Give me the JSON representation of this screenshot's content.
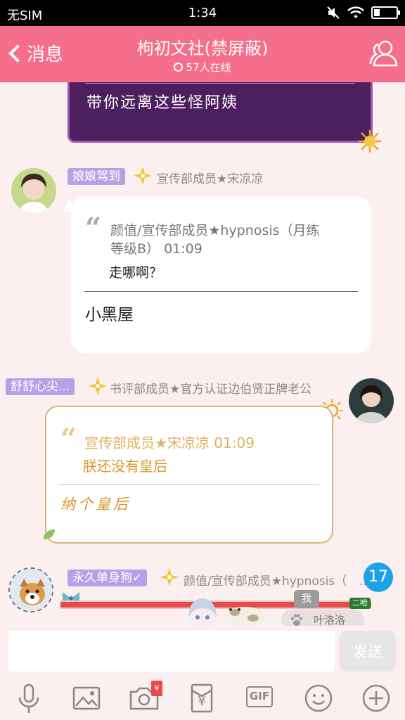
{
  "status": {
    "carrier": "无SIM",
    "time": "1:34"
  },
  "nav": {
    "back_label": "消息",
    "title": "枸初文社(禁屏蔽)",
    "online": "57人在线"
  },
  "messages": [
    {
      "text": "带你远离这些怪阿姨"
    },
    {
      "badge": "娘娘驾到",
      "meta": "宣传部成员★宋凉凉",
      "quote_head_1": "颜值/宣传部成员★hypnosis（月练",
      "quote_head_2": "等级B） 01:09",
      "quote_body": "走哪啊？",
      "reply": "小黑屋"
    },
    {
      "badge": "舒舒心尖...",
      "meta": "书评部成员★官方认证边伯贤正牌老公",
      "quote_head": "宣传部成员★宋凉凉 01:09",
      "quote_body": "朕还没有皇后",
      "reply": "纳个皇后"
    },
    {
      "badge": "永久单身狗✓",
      "meta": "颜值/宣传部成员★hypnosis（",
      "meta_trail": "..."
    }
  ],
  "unread_count": "17",
  "banner": {
    "tag": "二哈",
    "me": "我",
    "user": "叶洛洛"
  },
  "composer": {
    "placeholder": "",
    "send_label": "发送"
  },
  "toolbar": {
    "gif_label": "GIF",
    "red_packet_symbol": "¥"
  },
  "colors": {
    "nav_bg": "#f56f8c",
    "badge_bg": "#b8a0e8",
    "unread_bg": "#1ea1e6",
    "gold_text": "#d9972c"
  }
}
